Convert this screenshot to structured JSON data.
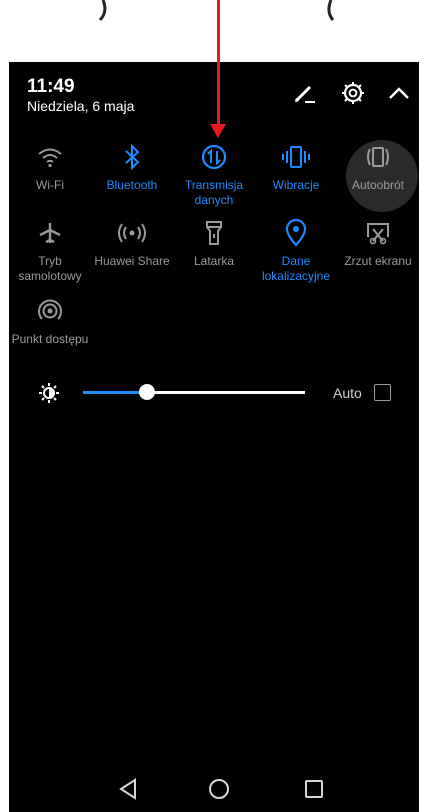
{
  "status": {
    "time": "11:49",
    "date": "Niedziela, 6 maja"
  },
  "header_icons": [
    "edit-icon",
    "settings-icon",
    "collapse-icon"
  ],
  "tiles": [
    {
      "label": "Wi-Fi",
      "active": false,
      "icon": "wifi-icon"
    },
    {
      "label": "Bluetooth",
      "active": true,
      "icon": "bluetooth-icon"
    },
    {
      "label": "Transmisja danych",
      "active": true,
      "icon": "mobile-data-icon"
    },
    {
      "label": "Wibracje",
      "active": true,
      "icon": "vibration-icon"
    },
    {
      "label": "Autoobrót",
      "active": false,
      "icon": "auto-rotate-icon"
    },
    {
      "label": "Tryb samolotowy",
      "active": false,
      "icon": "airplane-icon"
    },
    {
      "label": "Huawei Share",
      "active": false,
      "icon": "huawei-share-icon"
    },
    {
      "label": "Latarka",
      "active": false,
      "icon": "flashlight-icon"
    },
    {
      "label": "Dane lokalizacyjne",
      "active": true,
      "icon": "location-icon"
    },
    {
      "label": "Zrzut ekranu",
      "active": false,
      "icon": "screenshot-icon"
    },
    {
      "label": "Punkt dostępu",
      "active": false,
      "icon": "hotspot-icon"
    }
  ],
  "brightness": {
    "level": 0.29,
    "auto_label": "Auto",
    "auto_checked": false
  },
  "colors": {
    "accent": "#1e8bff",
    "annotation_arrow": "#e11b22"
  }
}
